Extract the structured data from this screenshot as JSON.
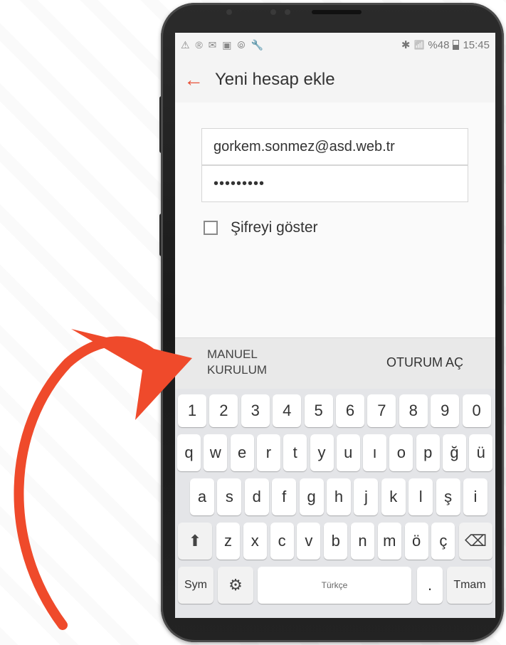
{
  "status_bar": {
    "left_icons": "⚠ ® ✉ ▣ ⦾ 🔧",
    "bluetooth_icon": "✱",
    "wifi_signal_icon": "📶",
    "battery_text": "%48",
    "time": "15:45"
  },
  "app_bar": {
    "back_icon": "←",
    "title": "Yeni hesap ekle"
  },
  "form": {
    "email_value": "gorkem.sonmez@asd.web.tr",
    "password_value": "•••••••••",
    "show_password_label": "Şifreyi göster"
  },
  "actions": {
    "manual_setup_line1": "MANUEL",
    "manual_setup_line2": "KURULUM",
    "sign_in": "OTURUM AÇ"
  },
  "keyboard": {
    "row_numbers": [
      "1",
      "2",
      "3",
      "4",
      "5",
      "6",
      "7",
      "8",
      "9",
      "0"
    ],
    "row_1": [
      "q",
      "w",
      "e",
      "r",
      "t",
      "y",
      "u",
      "ı",
      "o",
      "p",
      "ğ",
      "ü"
    ],
    "row_2": [
      "a",
      "s",
      "d",
      "f",
      "g",
      "h",
      "j",
      "k",
      "l",
      "ş",
      "i"
    ],
    "row_3": [
      "z",
      "x",
      "c",
      "v",
      "b",
      "n",
      "m",
      "ö",
      "ç"
    ],
    "shift_icon": "⬆",
    "backspace_icon": "⌫",
    "sym_label": "Sym",
    "settings_icon": "⚙",
    "space_label": "Türkçe",
    "period_label": ".",
    "done_label": "Tmam"
  },
  "colors": {
    "accent": "#e8533a",
    "arrow": "#ef4a2b"
  }
}
